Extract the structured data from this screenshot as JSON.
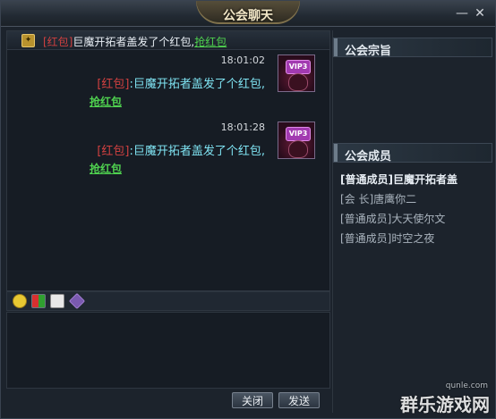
{
  "window": {
    "title": "公会聊天",
    "minimize_glyph": "—",
    "close_glyph": "✕"
  },
  "announcement": {
    "icon": "badge-icon",
    "tag": "[红包]",
    "text": "巨魔开拓者盖发了个红包,",
    "link": "抢红包"
  },
  "messages": [
    {
      "time": "18:01:02",
      "tag": "[红包]",
      "text": ":巨魔开拓者盖发了个红包,",
      "link": "抢红包",
      "avatar_vip": "VIP3"
    },
    {
      "time": "18:01:28",
      "tag": "[红包]",
      "text": ":巨魔开拓者盖发了个红包,",
      "link": "抢红包",
      "avatar_vip": "VIP3"
    }
  ],
  "toolbar": {
    "tools": [
      "smile-icon",
      "color-palette-icon",
      "dice-icon",
      "brush-icon"
    ]
  },
  "buttons": {
    "close_label": "关闭",
    "send_label": "发送"
  },
  "right": {
    "purpose_header": "公会宗旨",
    "members_header": "公会成员",
    "members": [
      "[普通成员]巨魔开拓者盖",
      "[会    长]唐鹰你二",
      "[普通成员]大天使尔文",
      "[普通成员]时空之夜"
    ]
  },
  "watermark": {
    "main": "群乐游戏网",
    "sub": "qunle.com"
  },
  "colors": {
    "red_tag": "#d04040",
    "cyan_text": "#7fe3f2",
    "green_link": "#4fd14f",
    "title_text": "#f2e7c7"
  }
}
